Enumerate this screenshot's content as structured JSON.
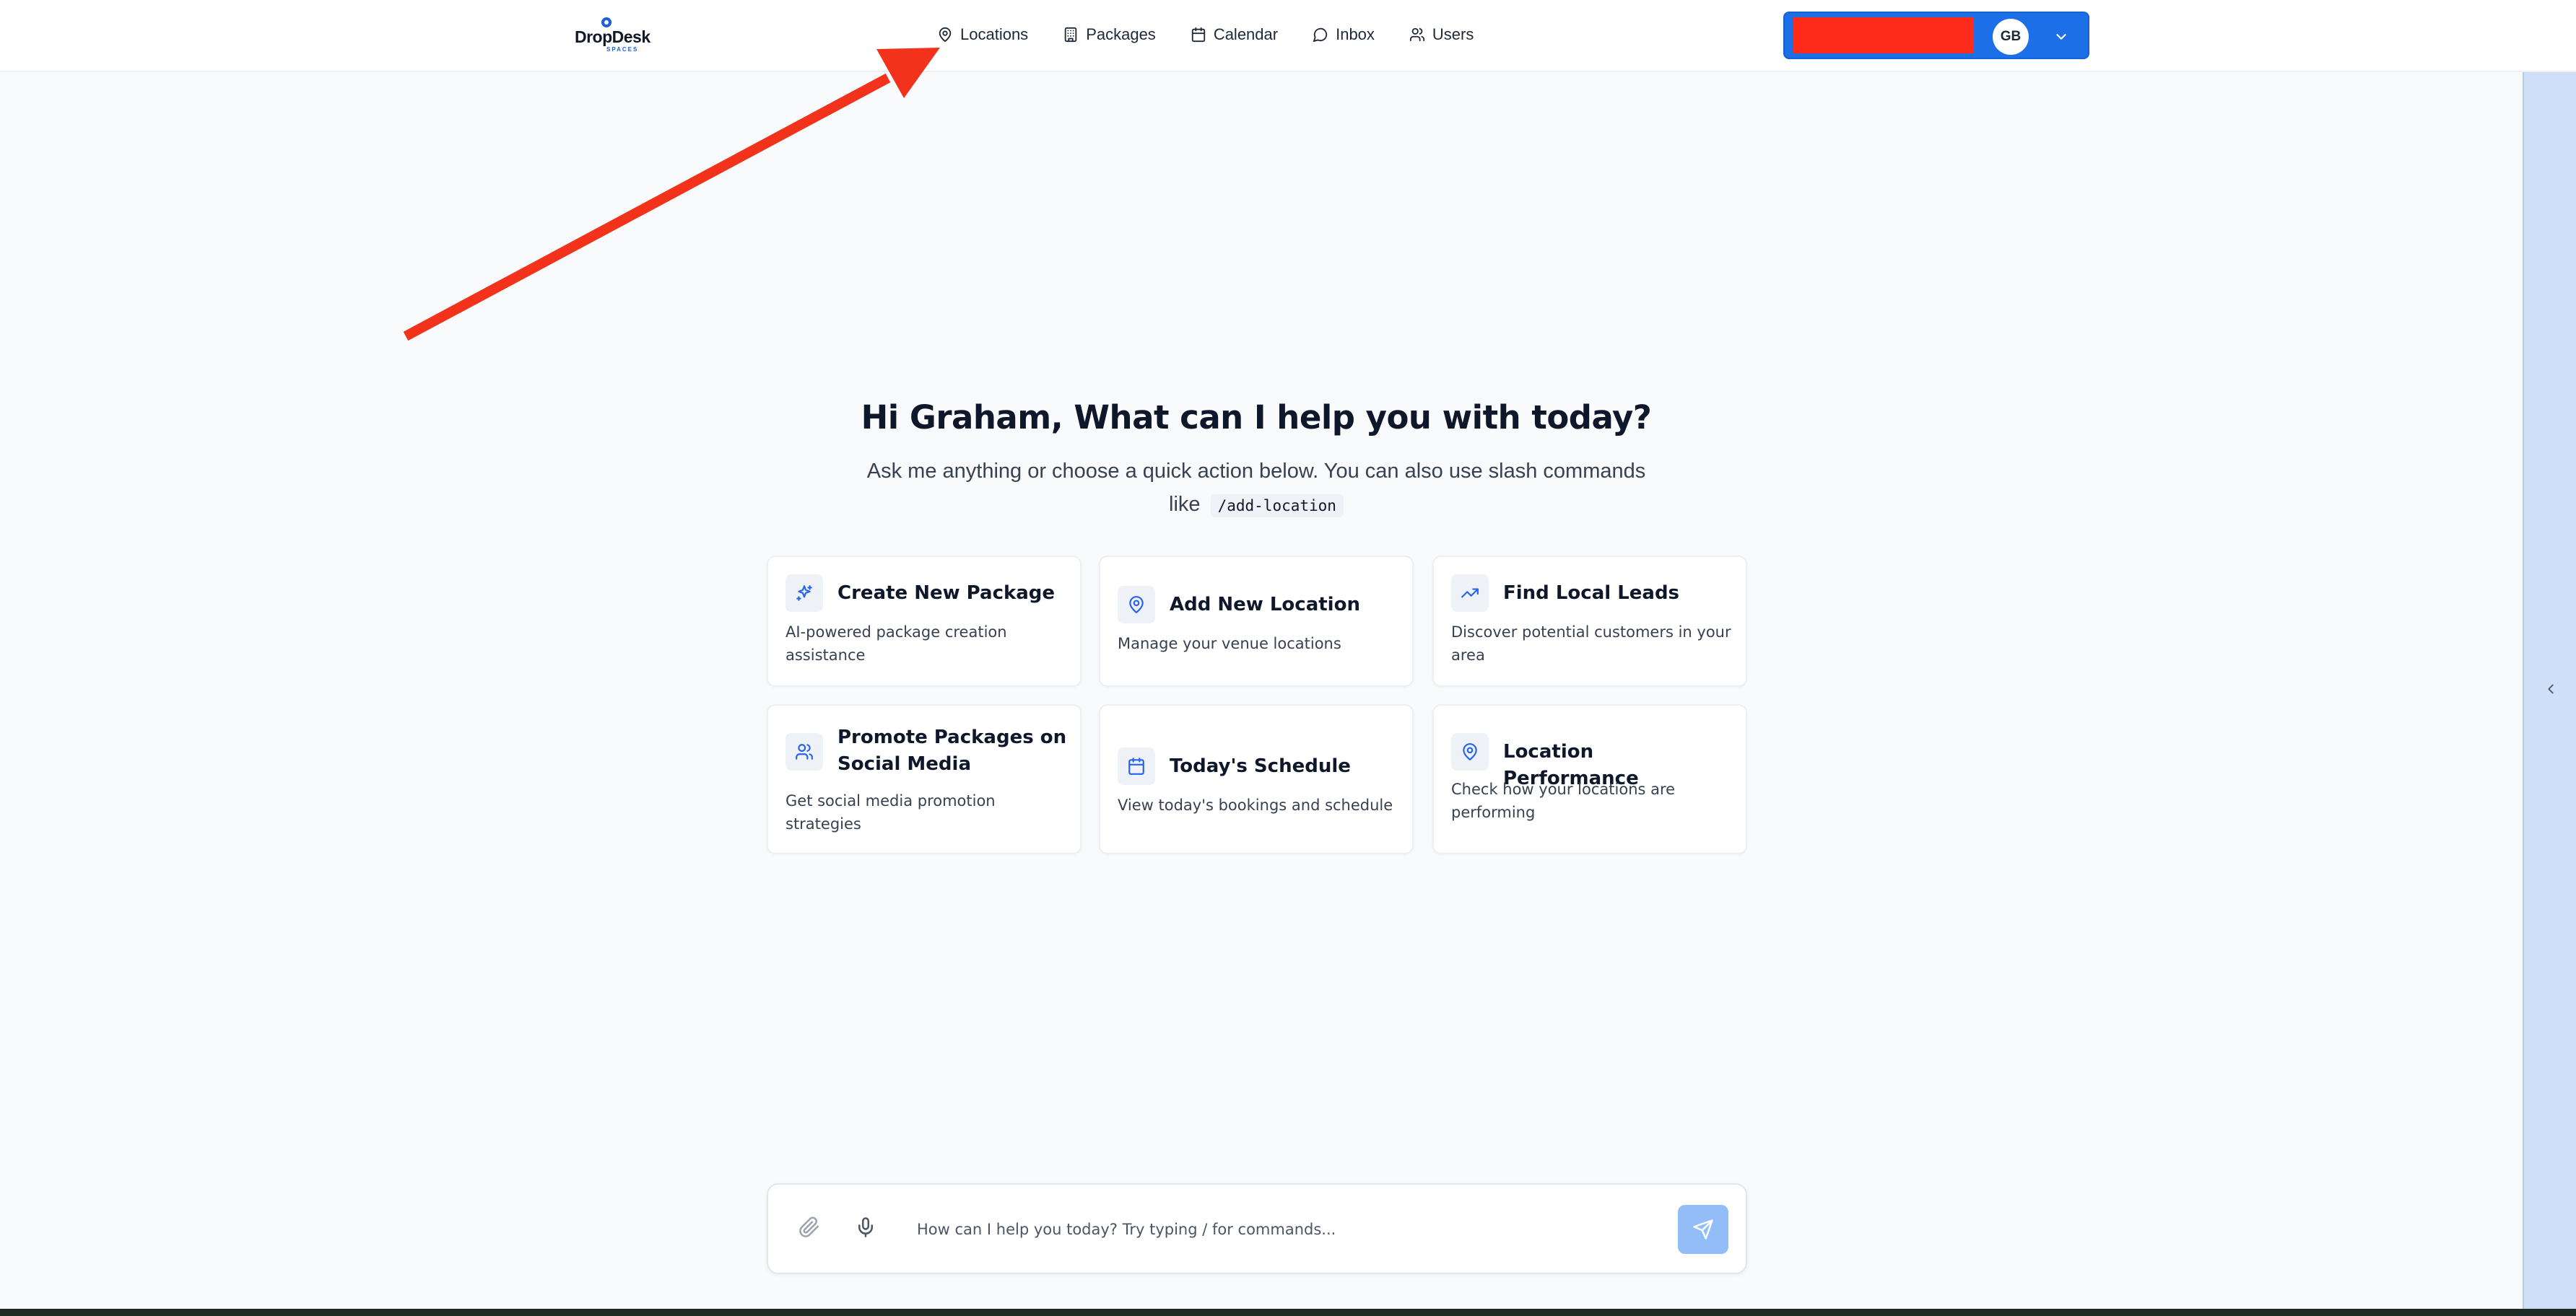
{
  "brand": {
    "name": "DropDesk",
    "sub": "SPACES"
  },
  "nav": {
    "items": [
      {
        "label": "Locations",
        "icon": "map-pin-icon"
      },
      {
        "label": "Packages",
        "icon": "building-icon"
      },
      {
        "label": "Calendar",
        "icon": "calendar-icon"
      },
      {
        "label": "Inbox",
        "icon": "message-circle-icon"
      },
      {
        "label": "Users",
        "icon": "users-icon"
      }
    ]
  },
  "account": {
    "initials": "GB",
    "accent": "#1d6fe8",
    "redaction_color": "#ff2b1a"
  },
  "hero": {
    "title": "Hi Graham, What can I help you with today?",
    "subtitle": "Ask me anything or choose a quick action below. You can also use slash commands like",
    "command": "/add-location"
  },
  "cards": [
    {
      "title": "Create New Package",
      "desc": "AI-powered package creation assistance",
      "icon": "sparkles-icon"
    },
    {
      "title": "Add New Location",
      "desc": "Manage your venue locations",
      "icon": "map-pin-icon"
    },
    {
      "title": "Find Local Leads",
      "desc": "Discover potential customers in your area",
      "icon": "trending-up-icon"
    },
    {
      "title": "Promote Packages on Social Media",
      "desc": "Get social media promotion strategies",
      "icon": "users-icon"
    },
    {
      "title": "Today's Schedule",
      "desc": "View today's bookings and schedule",
      "icon": "calendar-icon"
    },
    {
      "title": "Location Performance",
      "desc": "Check how your locations are performing",
      "icon": "map-pin-icon"
    }
  ],
  "chat": {
    "placeholder": "How can I help you today? Try typing / for commands..."
  },
  "colors": {
    "annotation_arrow": "#f2321a",
    "send_button": "#93bdf7",
    "icon_blue": "#2563eb"
  }
}
